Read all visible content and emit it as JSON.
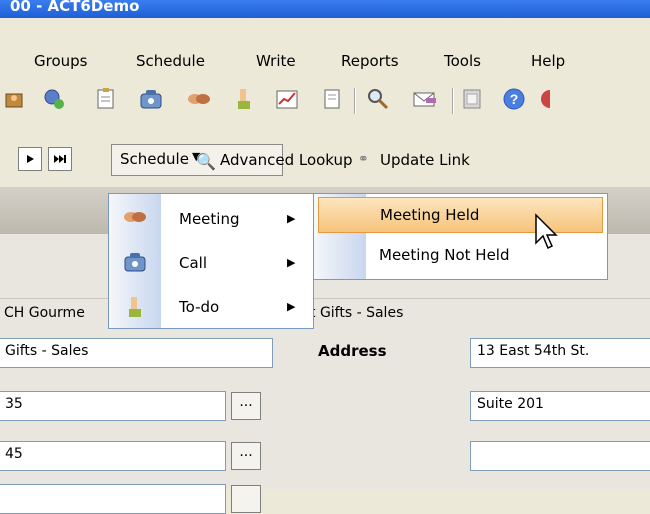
{
  "window": {
    "title": "00 - ACT6Demo"
  },
  "menubar": {
    "items": [
      "Groups",
      "Schedule",
      "Write",
      "Reports",
      "Tools",
      "Help"
    ]
  },
  "toolbar": {
    "icons": [
      "contacts-icon",
      "lookup-icon",
      "notes-icon",
      "call-icon",
      "meeting-icon",
      "todo-icon",
      "chart-icon",
      "document-icon",
      "search-icon",
      "email-icon",
      "calendar-icon",
      "help-icon"
    ]
  },
  "navbar": {
    "schedule_label": "Schedule",
    "advanced_lookup_label": "Advanced Lookup",
    "update_link_label": "Update Link"
  },
  "dropdown": {
    "items": [
      {
        "label": "Meeting"
      },
      {
        "label": "Call"
      },
      {
        "label": "To-do"
      }
    ]
  },
  "submenu": {
    "items": [
      {
        "label": "Meeting Held"
      },
      {
        "label": "Meeting Not Held"
      }
    ]
  },
  "form": {
    "company_partial": "CH Gourme",
    "company_partial2": "t Gifts - Sales",
    "field1": "Gifts - Sales",
    "field2": "35",
    "field3": "45",
    "dots_label": "...",
    "address_label": "Address",
    "address1": "13 East 54th St.",
    "address2": "Suite 201",
    "address3": ""
  },
  "colors": {
    "highlight": "#f6c37b",
    "menu_border": "#7a99c0",
    "titlebar": "#1f5fd6"
  }
}
